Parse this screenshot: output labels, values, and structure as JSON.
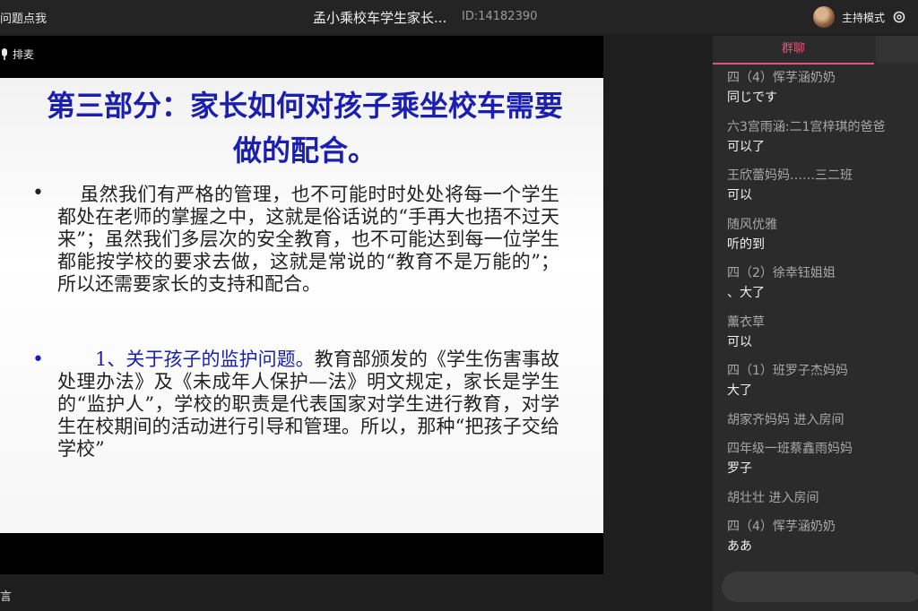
{
  "topbar": {
    "left_text": "问题点我",
    "title": "孟小乘校车学生家长...",
    "id_text": "ID:14182390",
    "host_label": "主持模式"
  },
  "stage": {
    "mic_label": "排麦"
  },
  "slide": {
    "title": "第三部分：家长如何对孩子乘坐校车需要做的配合。",
    "bullet1": "虽然我们有严格的管理，也不可能时时处处将每一个学生都处在老师的掌握之中，这就是俗话说的“手再大也捂不过天来”；虽然我们多层次的安全教育，也不可能达到每一位学生都能按学校的要求去做，这就是常说的“教育不是万能的”；所以还需要家长的支持和配合。",
    "bullet2_highlight": "1、关于孩子的监护问题。",
    "bullet2_rest": "教育部颁发的《学生伤害事故处理办法》及《未成年人保护—法》明文规定，家长是学生的“监护人”，学校的职责是代表国家对学生进行教育，对学生在校期间的活动进行引导和管理。所以，那种“把孩子交给学校”"
  },
  "bottom": {
    "label": "言"
  },
  "chat": {
    "tab_label": "群聊",
    "entries": [
      {
        "name": "四（4）恽芓涵奶奶",
        "text": "同じです"
      },
      {
        "name": "六3宫雨涵:二1宫梓琪的爸爸",
        "text": "可以了"
      },
      {
        "name": "王欣蕾妈妈……三二班",
        "text": "可以"
      },
      {
        "name": "随风优雅",
        "text": "听的到"
      },
      {
        "name": "四（2）徐幸钰姐姐",
        "text": "、大了"
      },
      {
        "name": "薰衣草",
        "text": "可以"
      },
      {
        "name": "四（1）班罗子杰妈妈",
        "text": "大了"
      },
      {
        "system": "胡家齐妈妈 进入房间"
      },
      {
        "name": "四年级一班蔡鑫雨妈妈",
        "text": "罗子"
      },
      {
        "system": "胡壮壮 进入房间"
      },
      {
        "name": "四（4）恽芓涵奶奶",
        "text": "ああ"
      }
    ],
    "input_placeholder": ""
  }
}
